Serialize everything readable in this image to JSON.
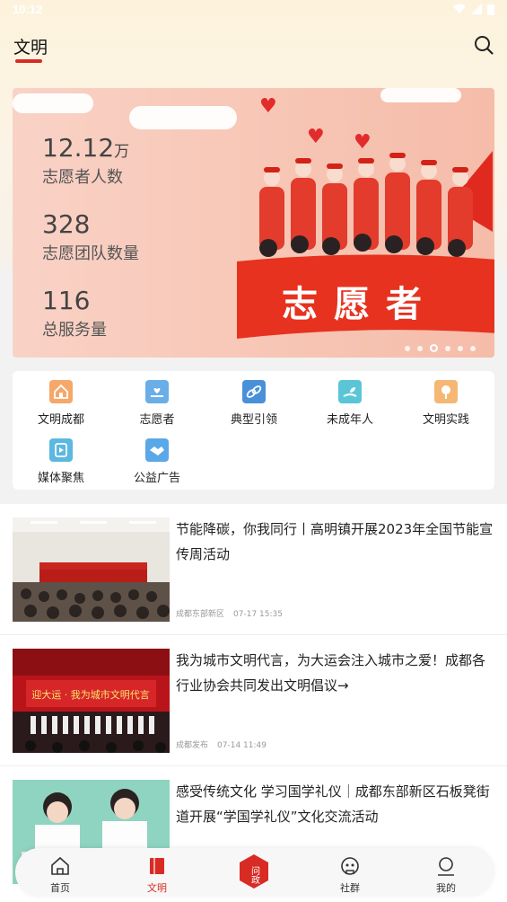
{
  "status": {
    "time": "10:12"
  },
  "header": {
    "title": "文明"
  },
  "banner": {
    "stats": [
      {
        "value": "12.12",
        "unit": "万",
        "label": "志愿者人数"
      },
      {
        "value": "328",
        "unit": "",
        "label": "志愿团队数量"
      },
      {
        "value": "116",
        "unit": "",
        "label": "总服务量"
      }
    ],
    "flag_text": "志愿者",
    "slide_count": 6,
    "active_slide": 3
  },
  "menu": [
    {
      "label": "文明成都",
      "icon": "house-icon",
      "color": "#f5a86a"
    },
    {
      "label": "志愿者",
      "icon": "heart-hand-icon",
      "color": "#6aaee8"
    },
    {
      "label": "典型引领",
      "icon": "link-icon",
      "color": "#4a90d9"
    },
    {
      "label": "未成年人",
      "icon": "sprout-hand-icon",
      "color": "#5bc5d8"
    },
    {
      "label": "文明实践",
      "icon": "tree-icon",
      "color": "#f5b774"
    },
    {
      "label": "媒体聚焦",
      "icon": "media-icon",
      "color": "#5bb8e0"
    },
    {
      "label": "公益广告",
      "icon": "handshake-icon",
      "color": "#5aa8e8"
    }
  ],
  "news": [
    {
      "title": "节能降碳，你我同行丨高明镇开展2023年全国节能宣传周活动",
      "source": "成都东部新区",
      "time": "07-17 15:35"
    },
    {
      "title": "我为城市文明代言，为大运会注入城市之爱！成都各行业协会共同发出文明倡议→",
      "source": "成都发布",
      "time": "07-14 11:49"
    },
    {
      "title": "感受传统文化 学习国学礼仪｜成都东部新区石板凳街道开展“学国学礼仪”文化交流活动",
      "source": "",
      "time": ""
    }
  ],
  "thumb_text": {
    "news2_banner": "迎大运 · 我为城市文明代言"
  },
  "tabbar": [
    {
      "label": "首页",
      "icon": "home-icon"
    },
    {
      "label": "文明",
      "icon": "book-icon",
      "active": true
    },
    {
      "label": "问政",
      "icon": "question-badge-icon"
    },
    {
      "label": "社群",
      "icon": "community-icon"
    },
    {
      "label": "我的",
      "icon": "user-icon"
    }
  ],
  "colors": {
    "accent": "#d82b24"
  }
}
